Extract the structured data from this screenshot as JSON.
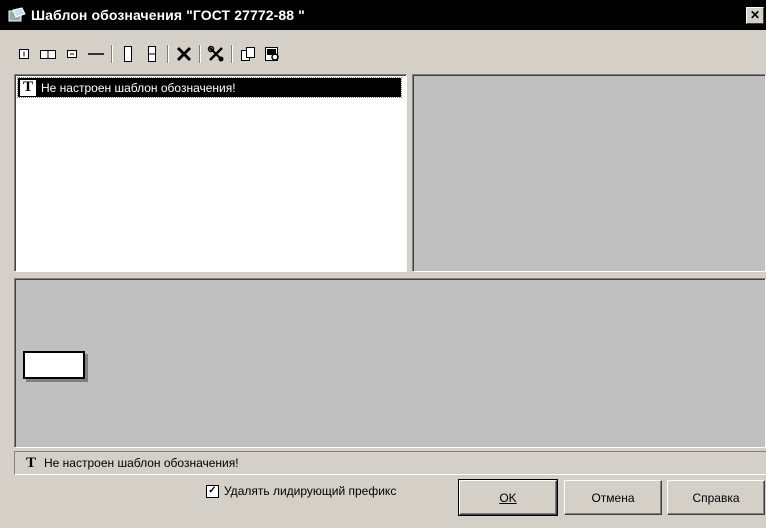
{
  "window": {
    "title": "Шаблон обозначения \"ГОСТ 27772-88 \"",
    "close_glyph": "✕"
  },
  "toolbar": {
    "icons": [
      "insert-field-icon",
      "insert-cells-icon",
      "insert-small-field-icon",
      "line-icon",
      "vertical-cell-icon",
      "vertical-split-icon",
      "delete-icon",
      "settings-icon",
      "copy-icon",
      "preview-icon"
    ]
  },
  "tree": {
    "selected_item": "Не настроен шаблон обозначения!",
    "item_icon_glyph": "T"
  },
  "status": {
    "icon_glyph": "T",
    "text": "Не настроен шаблон обозначения!"
  },
  "options": {
    "strip_prefix_label": "Удалять лидирующий префикс",
    "strip_prefix_checked": true,
    "check_glyph": "✓"
  },
  "buttons": {
    "ok": "OK",
    "cancel": "Отмена",
    "help": "Справка"
  }
}
